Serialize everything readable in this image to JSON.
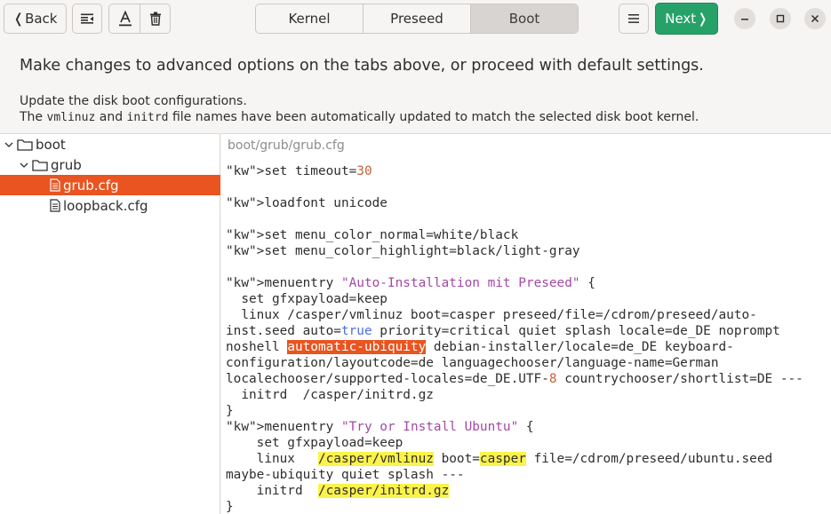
{
  "header": {
    "back_label": "Back",
    "next_label": "Next",
    "tabs": [
      {
        "label": "Kernel",
        "active": false
      },
      {
        "label": "Preseed",
        "active": false
      },
      {
        "label": "Boot",
        "active": true
      }
    ],
    "icons": [
      "chevron-left-icon",
      "sidebar-toggle-icon",
      "font-icon",
      "trash-icon",
      "menu-icon",
      "chevron-right-icon",
      "minimize-icon",
      "maximize-icon",
      "close-icon"
    ]
  },
  "info": {
    "headline": "Make changes to advanced options on the tabs above, or proceed with default settings.",
    "line1": "Update the disk boot configurations.",
    "line2_pre": "The ",
    "line2_code1": "vmlinuz",
    "line2_mid": " and ",
    "line2_code2": "initrd",
    "line2_post": " file names have been automatically updated to match the selected disk boot kernel."
  },
  "tree": {
    "items": [
      {
        "label": "boot",
        "type": "folder",
        "depth": 0,
        "selected": false
      },
      {
        "label": "grub",
        "type": "folder",
        "depth": 1,
        "selected": false
      },
      {
        "label": "grub.cfg",
        "type": "file",
        "depth": 2,
        "selected": true
      },
      {
        "label": "loopback.cfg",
        "type": "file",
        "depth": 2,
        "selected": false
      }
    ]
  },
  "editor": {
    "path": "boot/grub/grub.cfg",
    "code": "set timeout=30\n\nloadfont unicode\n\nset menu_color_normal=white/black\nset menu_color_highlight=black/light-gray\n\nmenuentry \"Auto-Installation mit Preseed\" {\n  set gfxpayload=keep\n  linux /casper/vmlinuz boot=casper preseed/file=/cdrom/preseed/auto-inst.seed auto=true priority=critical quiet splash locale=de_DE noprompt noshell automatic-ubiquity debian-installer/locale=de_DE keyboard-configuration/layoutcode=de languagechooser/language-name=German localechooser/supported-locales=de_DE.UTF-8 countrychooser/shortlist=DE ---\n  initrd  /casper/initrd.gz\n}\nmenuentry \"Try or Install Ubuntu\" {\n    set gfxpayload=keep\n    linux   /casper/vmlinuz boot=casper file=/cdrom/preseed/ubuntu.seed maybe-ubiquity quiet splash ---\n    initrd  /casper/initrd.gz\n}",
    "colors": {
      "keyword": "#26823b",
      "number": "#c4623a",
      "string": "#a349a4",
      "boolean": "#4f6fd4",
      "highlight_orange": "#e95420",
      "highlight_yellow": "#fbf34b"
    }
  },
  "colors": {
    "accent": "#e95420",
    "next_button": "#26a269"
  }
}
